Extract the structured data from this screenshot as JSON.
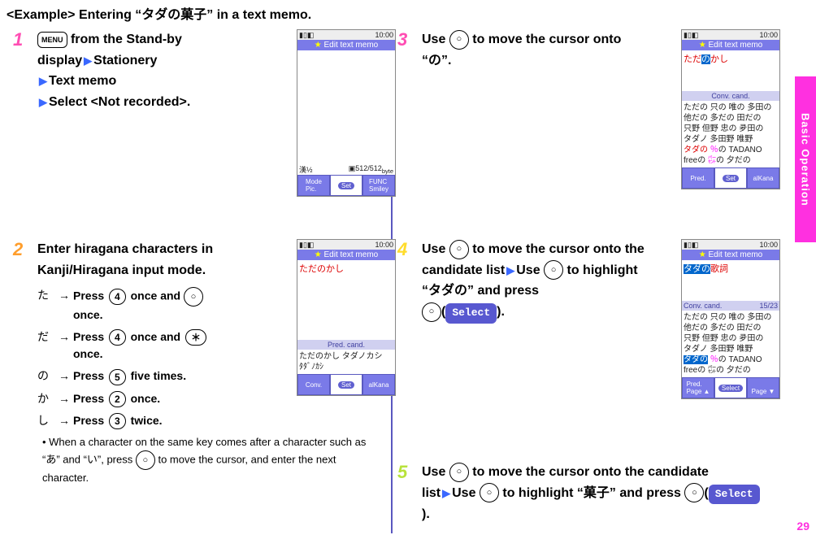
{
  "header": "<Example> Entering “タダの菓子” in a text memo.",
  "side_tab": "Basic Operation",
  "page_number": "29",
  "icons": {
    "menu": "MENU",
    "nav_center": "○",
    "star": "＊"
  },
  "keys": {
    "k2": "2",
    "k3": "3",
    "k4": "4",
    "k5": "5"
  },
  "select_label": "Select",
  "tri": "▶",
  "arrow": "→",
  "steps": {
    "1": {
      "num": "1",
      "line_a_prefix": "",
      "line_a_suffix": " from the Stand-by display",
      "line_b": "Stationery",
      "line_c": "Text memo",
      "line_d": "Select <Not recorded>."
    },
    "2": {
      "num": "2",
      "title": "Enter hiragana characters in Kanji/Hiragana input mode.",
      "sub": [
        {
          "jp": "た",
          "txt_a": "Press ",
          "key": "4",
          "txt_b": " once and ",
          "key2": "nav",
          "txt_c": " once."
        },
        {
          "jp": "だ",
          "txt_a": "Press ",
          "key": "4",
          "txt_b": " once and ",
          "key2": "star",
          "txt_c": " once."
        },
        {
          "jp": "の",
          "txt_a": "Press ",
          "key": "5",
          "txt_b": " five times.",
          "key2": "",
          "txt_c": ""
        },
        {
          "jp": "か",
          "txt_a": "Press ",
          "key": "2",
          "txt_b": " once.",
          "key2": "",
          "txt_c": ""
        },
        {
          "jp": "し",
          "txt_a": "Press ",
          "key": "3",
          "txt_b": " twice.",
          "key2": "",
          "txt_c": ""
        }
      ],
      "note_a": "• When a character on the same key comes after a character such as “あ” and “い”, press ",
      "note_b": " to move the cursor, and enter the next character."
    },
    "3": {
      "num": "3",
      "txt_a": "Use ",
      "txt_b": " to move the cursor onto “",
      "txt_c": "の",
      "txt_d": "”."
    },
    "4": {
      "num": "4",
      "txt_a": "Use ",
      "txt_b": " to move the cursor onto the candidate list",
      "txt_c": "Use ",
      "txt_d": " to highlight “",
      "txt_e": "タダの",
      "txt_f": "” and press ",
      "txt_g": "(",
      "txt_h": ")."
    },
    "5": {
      "num": "5",
      "txt_a": "Use ",
      "txt_b": " to move the cursor onto the candidate list",
      "txt_c": "Use ",
      "txt_d": " to highlight “",
      "txt_e": "菓子",
      "txt_f": "” and press ",
      "txt_g": "(",
      "txt_h": ")."
    }
  },
  "phone1": {
    "time": "10:00",
    "title": "Edit text memo",
    "footer_mode": "漢½",
    "footer_count": "512/512",
    "bl": "Mode",
    "bl2": "Pic.",
    "br": "FUNC",
    "br2": "Smiley",
    "mid": "Set"
  },
  "phone2": {
    "time": "10:00",
    "title": "Edit text memo",
    "text": "ただのかし",
    "convlabel": "Pred. cand.",
    "cand_a": "ただのかし タダノカシ",
    "cand_b": "ﾀﾀﾞﾉｶｼ",
    "bl": "Conv.",
    "br": "alKana",
    "mid": "Set"
  },
  "phone3": {
    "time": "10:00",
    "title": "Edit text memo",
    "text": "ただのかし",
    "convlabel": "Conv. cand.",
    "cands": [
      "ただの 只の 唯の 多田の",
      "他だの 多だの 田だの",
      "只野 但野 忠の 夛田の",
      "タダノ 多田野 唯野",
      "タダの ％の TADANO",
      "freeの ㌫の 夕だの"
    ],
    "bl": "Pred.",
    "br": "alKana",
    "mid": "Set"
  },
  "phone4": {
    "time": "10:00",
    "title": "Edit text memo",
    "text": "タダの歌詞",
    "convlabel": "Conv. cand.",
    "convcount": "15/23",
    "cands": [
      "ただの 只の 唯の 多田の",
      "他だの 多だの 田だの",
      "只野 但野 忠の 夛田の",
      "タダノ 多田野 唯野",
      "freeの ㌫の 夕だの"
    ],
    "highlight_a": "タダの",
    "highlight_b": "％の TADANO",
    "bl": "Pred.",
    "bl2": "Page ▲",
    "br": "Page ▼",
    "mid": "Select"
  }
}
